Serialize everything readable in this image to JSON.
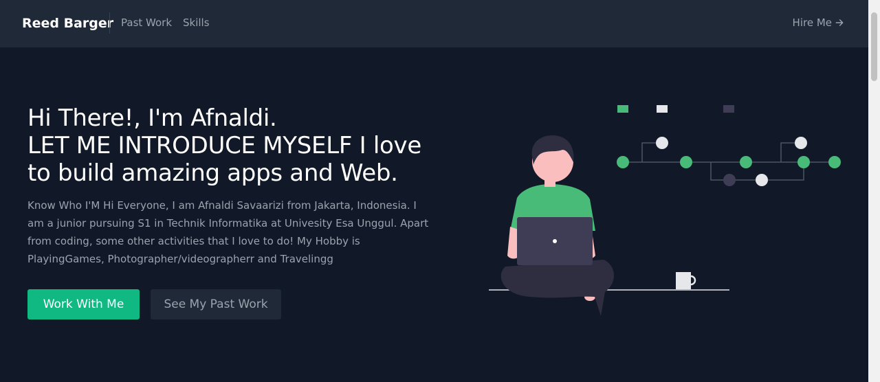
{
  "nav": {
    "brand": "Reed Barger",
    "links": [
      {
        "label": "Past Work"
      },
      {
        "label": "Skills"
      }
    ],
    "cta": "Hire Me",
    "cta_icon": "arrow-right-icon"
  },
  "hero": {
    "title_lines": [
      "Hi There!, I'm Afnaldi.",
      "LET ME INTRODUCE MYSELF I love",
      "to build amazing apps and Web."
    ],
    "description": "Know Who I'M Hi Everyone, I am Afnaldi Savaarizi from Jakarta, Indonesia. I am a junior pursuing S1 in Technik Informatika at Univesity Esa Unggul. Apart from coding, some other activities that I love to do! My Hobby is PlayingGames, Photographer/videographerr and Travelingg",
    "primary_button": "Work With Me",
    "secondary_button": "See My Past Work"
  },
  "colors": {
    "background": "#111827",
    "navbar": "#1f2937",
    "accent": "#10b981",
    "illustration_green": "#48bb78",
    "illustration_dark": "#3f3d56"
  }
}
